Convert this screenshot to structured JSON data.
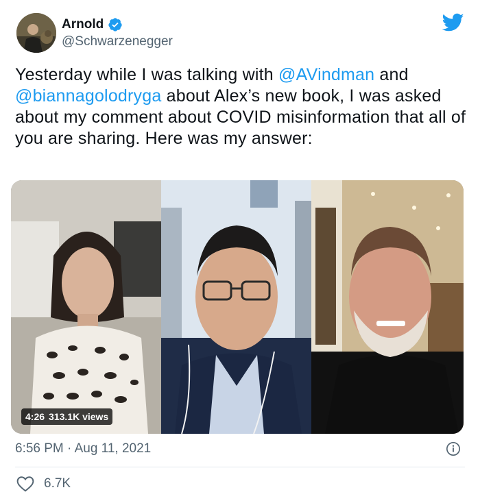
{
  "author": {
    "name": "Arnold",
    "handle": "@Schwarzenegger",
    "verified": true
  },
  "tweet": {
    "text_before_mention1": "Yesterday while I was talking with ",
    "mention1": "@AVindman",
    "text_between": " and ",
    "mention2": "@biannagolodryga",
    "text_after": " about Alex’s new book, I was asked about my comment about COVID misinformation that all of you are sharing. Here was my answer:"
  },
  "media": {
    "duration": "4:26",
    "views": "313.1K views"
  },
  "timestamp": "6:56 PM · Aug 11, 2021",
  "engagement": {
    "likes": "6.7K"
  },
  "icons": {
    "brand": "twitter-bird-icon",
    "verified": "verified-badge-icon",
    "info": "info-icon",
    "like": "heart-icon"
  },
  "colors": {
    "accent": "#1d9bf0",
    "secondary_text": "#536471",
    "primary_text": "#0f1419"
  }
}
